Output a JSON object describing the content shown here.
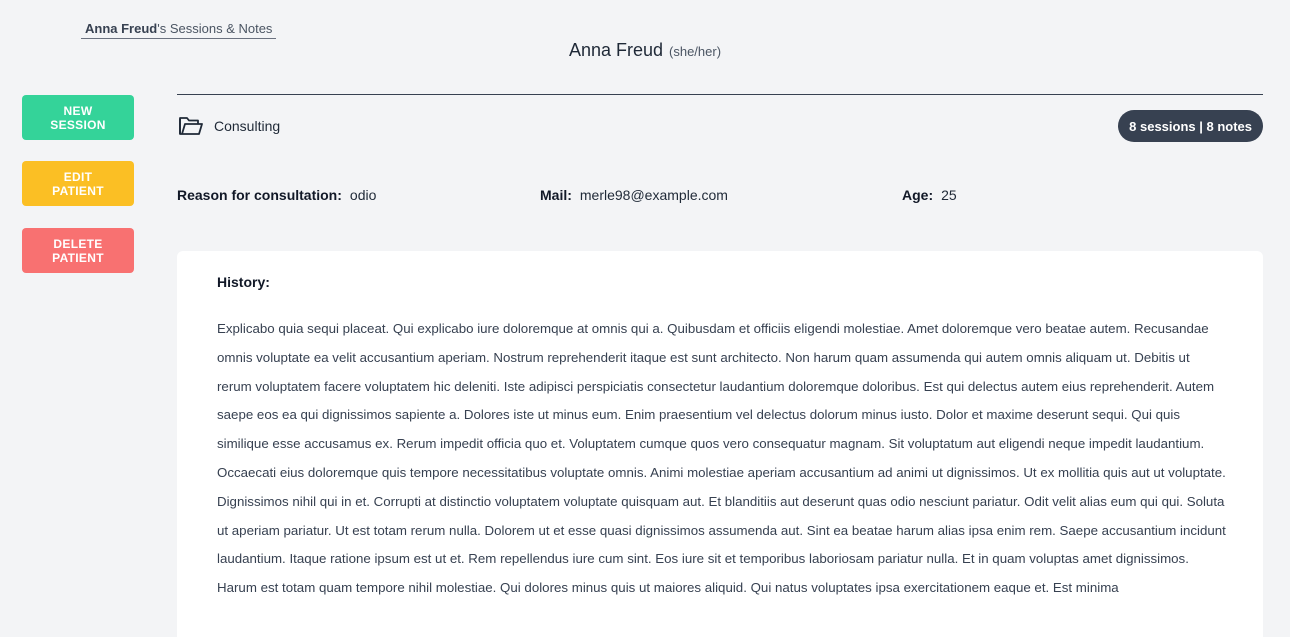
{
  "breadcrumb": {
    "owner": "Anna Freud",
    "suffix": "'s Sessions & Notes"
  },
  "patient": {
    "name": "Anna Freud",
    "pronouns": "(she/her)"
  },
  "actions": {
    "new_session": [
      "NEW",
      "SESSION"
    ],
    "edit_patient": [
      "EDIT",
      "PATIENT"
    ],
    "delete_patient": [
      "DELETE",
      "PATIENT"
    ]
  },
  "folder": {
    "icon": "folder-open-icon",
    "label": "Consulting"
  },
  "counts": {
    "label": "8 sessions | 8 notes"
  },
  "info": {
    "reason_label": "Reason for consultation:",
    "reason_value": "odio",
    "mail_label": "Mail:",
    "mail_value": "merle98@example.com",
    "age_label": "Age:",
    "age_value": "25"
  },
  "history": {
    "title": "History:",
    "text": "Explicabo quia sequi placeat. Qui explicabo iure doloremque at omnis qui a. Quibusdam et officiis eligendi molestiae. Amet doloremque vero beatae autem. Recusandae omnis voluptate ea velit accusantium aperiam. Nostrum reprehenderit itaque est sunt architecto. Non harum quam assumenda qui autem omnis aliquam ut. Debitis ut rerum voluptatem facere voluptatem hic deleniti. Iste adipisci perspiciatis consectetur laudantium doloremque doloribus. Est qui delectus autem eius reprehenderit. Autem saepe eos ea qui dignissimos sapiente a. Dolores iste ut minus eum. Enim praesentium vel delectus dolorum minus iusto. Dolor et maxime deserunt sequi. Qui quis similique esse accusamus ex. Rerum impedit officia quo et. Voluptatem cumque quos vero consequatur magnam. Sit voluptatum aut eligendi neque impedit laudantium. Occaecati eius doloremque quis tempore necessitatibus voluptate omnis. Animi molestiae aperiam accusantium ad animi ut dignissimos. Ut ex mollitia quis aut ut voluptate. Dignissimos nihil qui in et. Corrupti at distinctio voluptatem voluptate quisquam aut. Et blanditiis aut deserunt quas odio nesciunt pariatur. Odit velit alias eum qui qui. Soluta ut aperiam pariatur. Ut est totam rerum nulla. Dolorem ut et esse quasi dignissimos assumenda aut. Sint ea beatae harum alias ipsa enim rem. Saepe accusantium incidunt laudantium. Itaque ratione ipsum est ut et. Rem repellendus iure cum sint. Eos iure sit et temporibus laboriosam pariatur nulla. Et in quam voluptas amet dignissimos. Harum est totam quam tempore nihil molestiae. Qui dolores minus quis ut maiores aliquid. Qui natus voluptates ipsa exercitationem eaque et. Est minima"
  }
}
